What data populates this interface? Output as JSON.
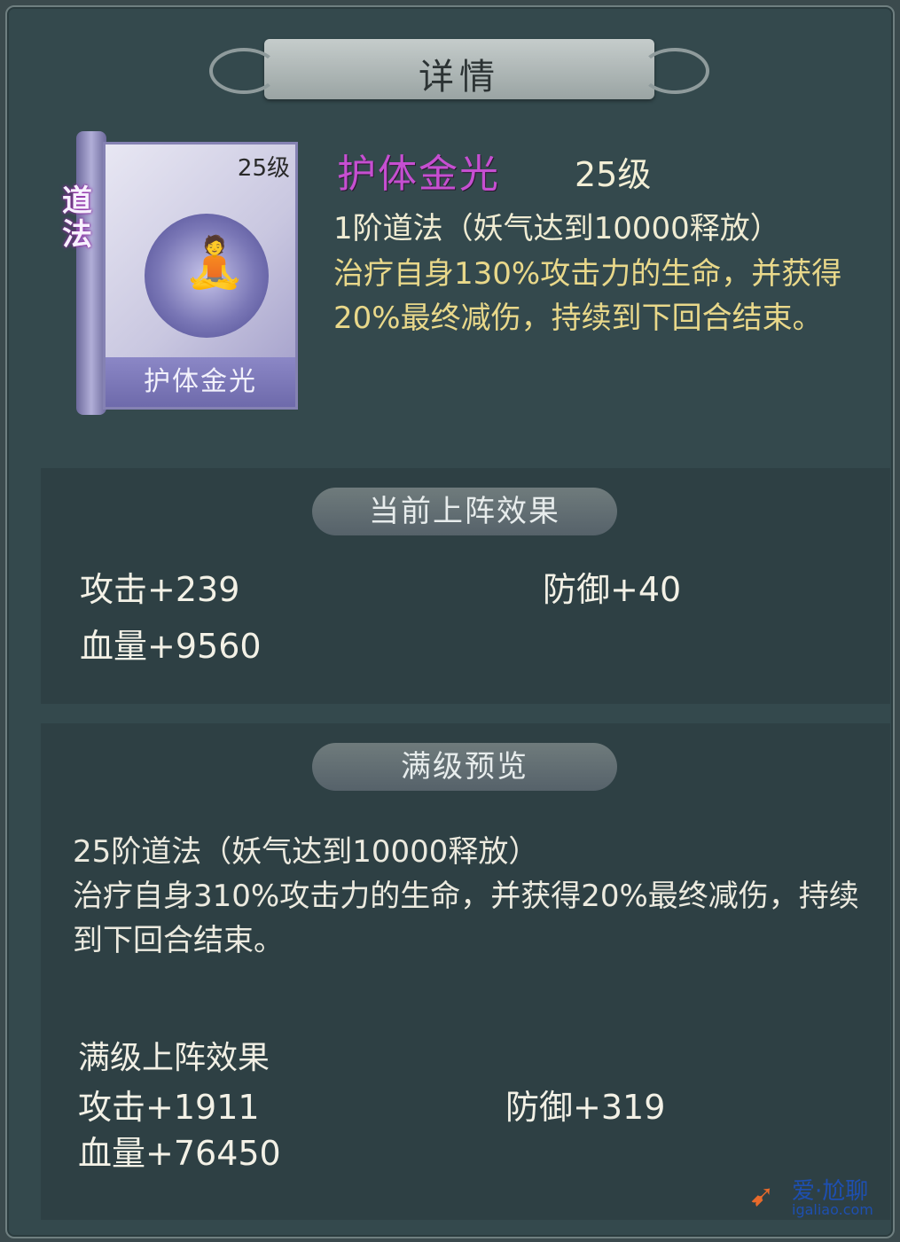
{
  "header": {
    "title": "详情"
  },
  "skill": {
    "card_level": "25级",
    "card_seal": "道法",
    "card_name": "护体金光",
    "name": "护体金光",
    "level": "25级",
    "tier": "1阶道法（妖气达到10000释放）",
    "description": "治疗自身130%攻击力的生命，并获得20%最终减伤，持续到下回合结束。"
  },
  "current": {
    "title": "当前上阵效果",
    "attack": "攻击+239",
    "defense": "防御+40",
    "hp": "血量+9560"
  },
  "preview": {
    "title": "满级预览",
    "tier": "25阶道法（妖气达到10000释放）",
    "description": "治疗自身310%攻击力的生命，并获得20%最终减伤，持续到下回合结束。",
    "full_title": "满级上阵效果",
    "attack": "攻击+1911",
    "defense": "防御+319",
    "hp": "血量+76450"
  },
  "watermark": {
    "line1": "爱·尬聊",
    "line2": "igaliao.com"
  },
  "icons": {
    "card_figure": "meditating-figure-icon",
    "watermark_bird": "bird-logo-icon"
  },
  "colors": {
    "skill_name": "#c64fd1",
    "description": "#e9d88a",
    "panel": "#34494d"
  }
}
